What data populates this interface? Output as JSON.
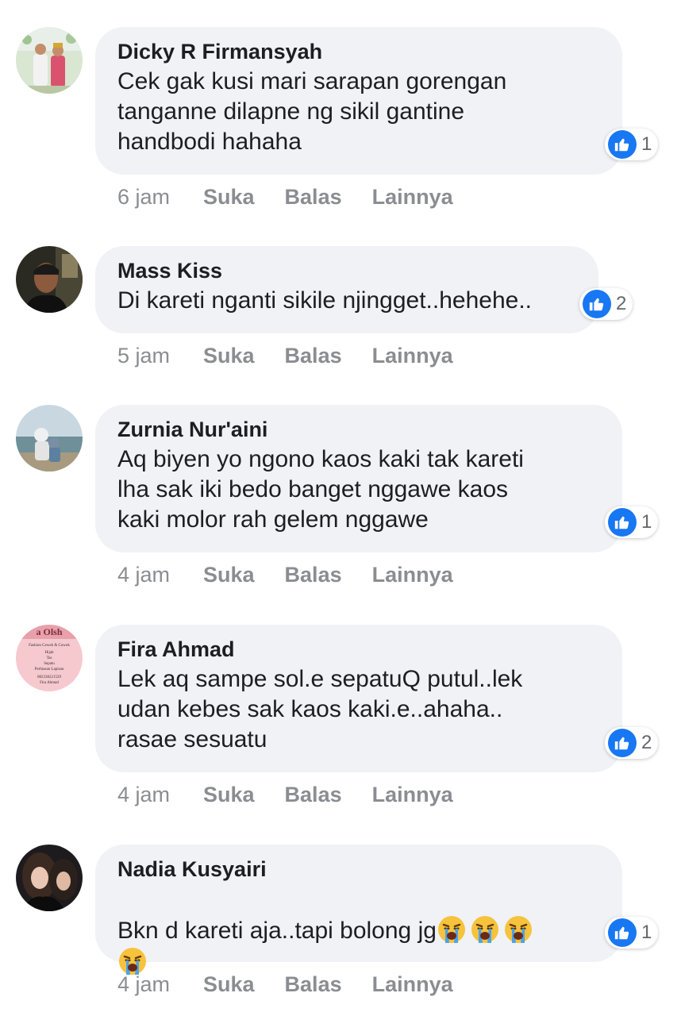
{
  "comments": [
    {
      "author": "Dicky R Firmansyah",
      "text": "Cek gak kusi mari sarapan gorengan\ntanganne dilapne ng sikil gantine\nhandbodi hahaha",
      "reactions": "1",
      "time": "6 jam",
      "like": "Suka",
      "reply": "Balas",
      "more": "Lainnya"
    },
    {
      "author": "Mass Kiss",
      "text": "Di kareti nganti sikile njingget..hehehe..",
      "reactions": "2",
      "time": "5 jam",
      "like": "Suka",
      "reply": "Balas",
      "more": "Lainnya"
    },
    {
      "author": "Zurnia Nur'aini",
      "text": "Aq biyen yo ngono kaos kaki tak kareti\nlha sak iki bedo banget nggawe kaos\nkaki molor rah gelem nggawe",
      "reactions": "1",
      "time": "4 jam",
      "like": "Suka",
      "reply": "Balas",
      "more": "Lainnya"
    },
    {
      "author": "Fira Ahmad",
      "text": "Lek aq sampe sol.e sepatuQ putul..lek\nudan kebes sak kaos kaki.e..ahaha..\nrasae sesuatu",
      "reactions": "2",
      "time": "4 jam",
      "like": "Suka",
      "reply": "Balas",
      "more": "Lainnya",
      "avatar_text": {
        "line1": "a Olsh",
        "line2": "Fashion Cewek & Cowok",
        "line3": "Hijab",
        "line4": "Tas",
        "line5": "Sepatu",
        "line6": "Perhiasan Lapisan",
        "line7": "082338221529",
        "line8": "Fira Ahmad"
      }
    },
    {
      "author": "Nadia Kusyairi",
      "text": "Bkn d kareti aja..tapi bolong jg",
      "reactions": "1",
      "time": "4 jam",
      "like": "Suka",
      "reply": "Balas",
      "more": "Lainnya",
      "emoji_name": "loudly-crying-face"
    }
  ],
  "colors": {
    "bubble": "#f0f2f5",
    "like_blue": "#1877f2",
    "action_gray": "#8a8d91"
  }
}
